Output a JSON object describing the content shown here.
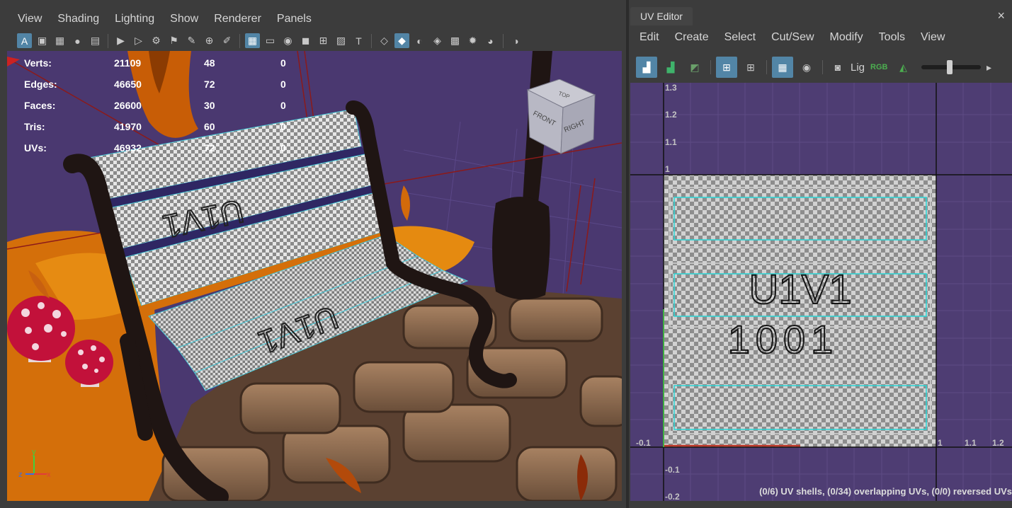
{
  "viewport_panel": {
    "menu": [
      "View",
      "Shading",
      "Lighting",
      "Show",
      "Renderer",
      "Panels"
    ],
    "hud": {
      "rows": [
        {
          "label": "Verts:",
          "v1": "21109",
          "v2": "48",
          "v3": "0"
        },
        {
          "label": "Edges:",
          "v1": "46650",
          "v2": "72",
          "v3": "0"
        },
        {
          "label": "Faces:",
          "v1": "26600",
          "v2": "30",
          "v3": "0"
        },
        {
          "label": "Tris:",
          "v1": "41970",
          "v2": "60",
          "v3": "0"
        },
        {
          "label": "UVs:",
          "v1": "46932",
          "v2": "72",
          "v3": "0"
        }
      ]
    },
    "viewcube": {
      "top": "TOP",
      "front": "FRONT",
      "right": "RIGHT"
    },
    "axis": {
      "x": "x",
      "y": "y",
      "z": "z"
    },
    "texture_text": "U1V1"
  },
  "uv_editor": {
    "tab_title": "UV Editor",
    "close_icon": "×",
    "menu": [
      "Edit",
      "Create",
      "Select",
      "Cut/Sew",
      "Modify",
      "Tools",
      "View"
    ],
    "toolbar_text": {
      "lighting": "Lig",
      "rgb": "RGB"
    },
    "grid_labels": {
      "y_top": [
        "1.3",
        "1.2",
        "1.1",
        "1"
      ],
      "y_bottom": [
        "-0.1",
        "-0.2"
      ],
      "x_left": "-0.1",
      "x_right": [
        "1",
        "1.1",
        "1.2"
      ]
    },
    "tile_text": {
      "line1": "U1V1",
      "line2": "1001"
    },
    "status": "(0/6) UV shells, (0/34) overlapping UVs, (0/0) reversed UVs"
  },
  "colors": {
    "background": "#4a3870",
    "accent": "#5285a6",
    "uv_shell": "#2ad6d6",
    "checker_light": "#e6e6e6",
    "checker_dark": "#8a8a8a"
  }
}
